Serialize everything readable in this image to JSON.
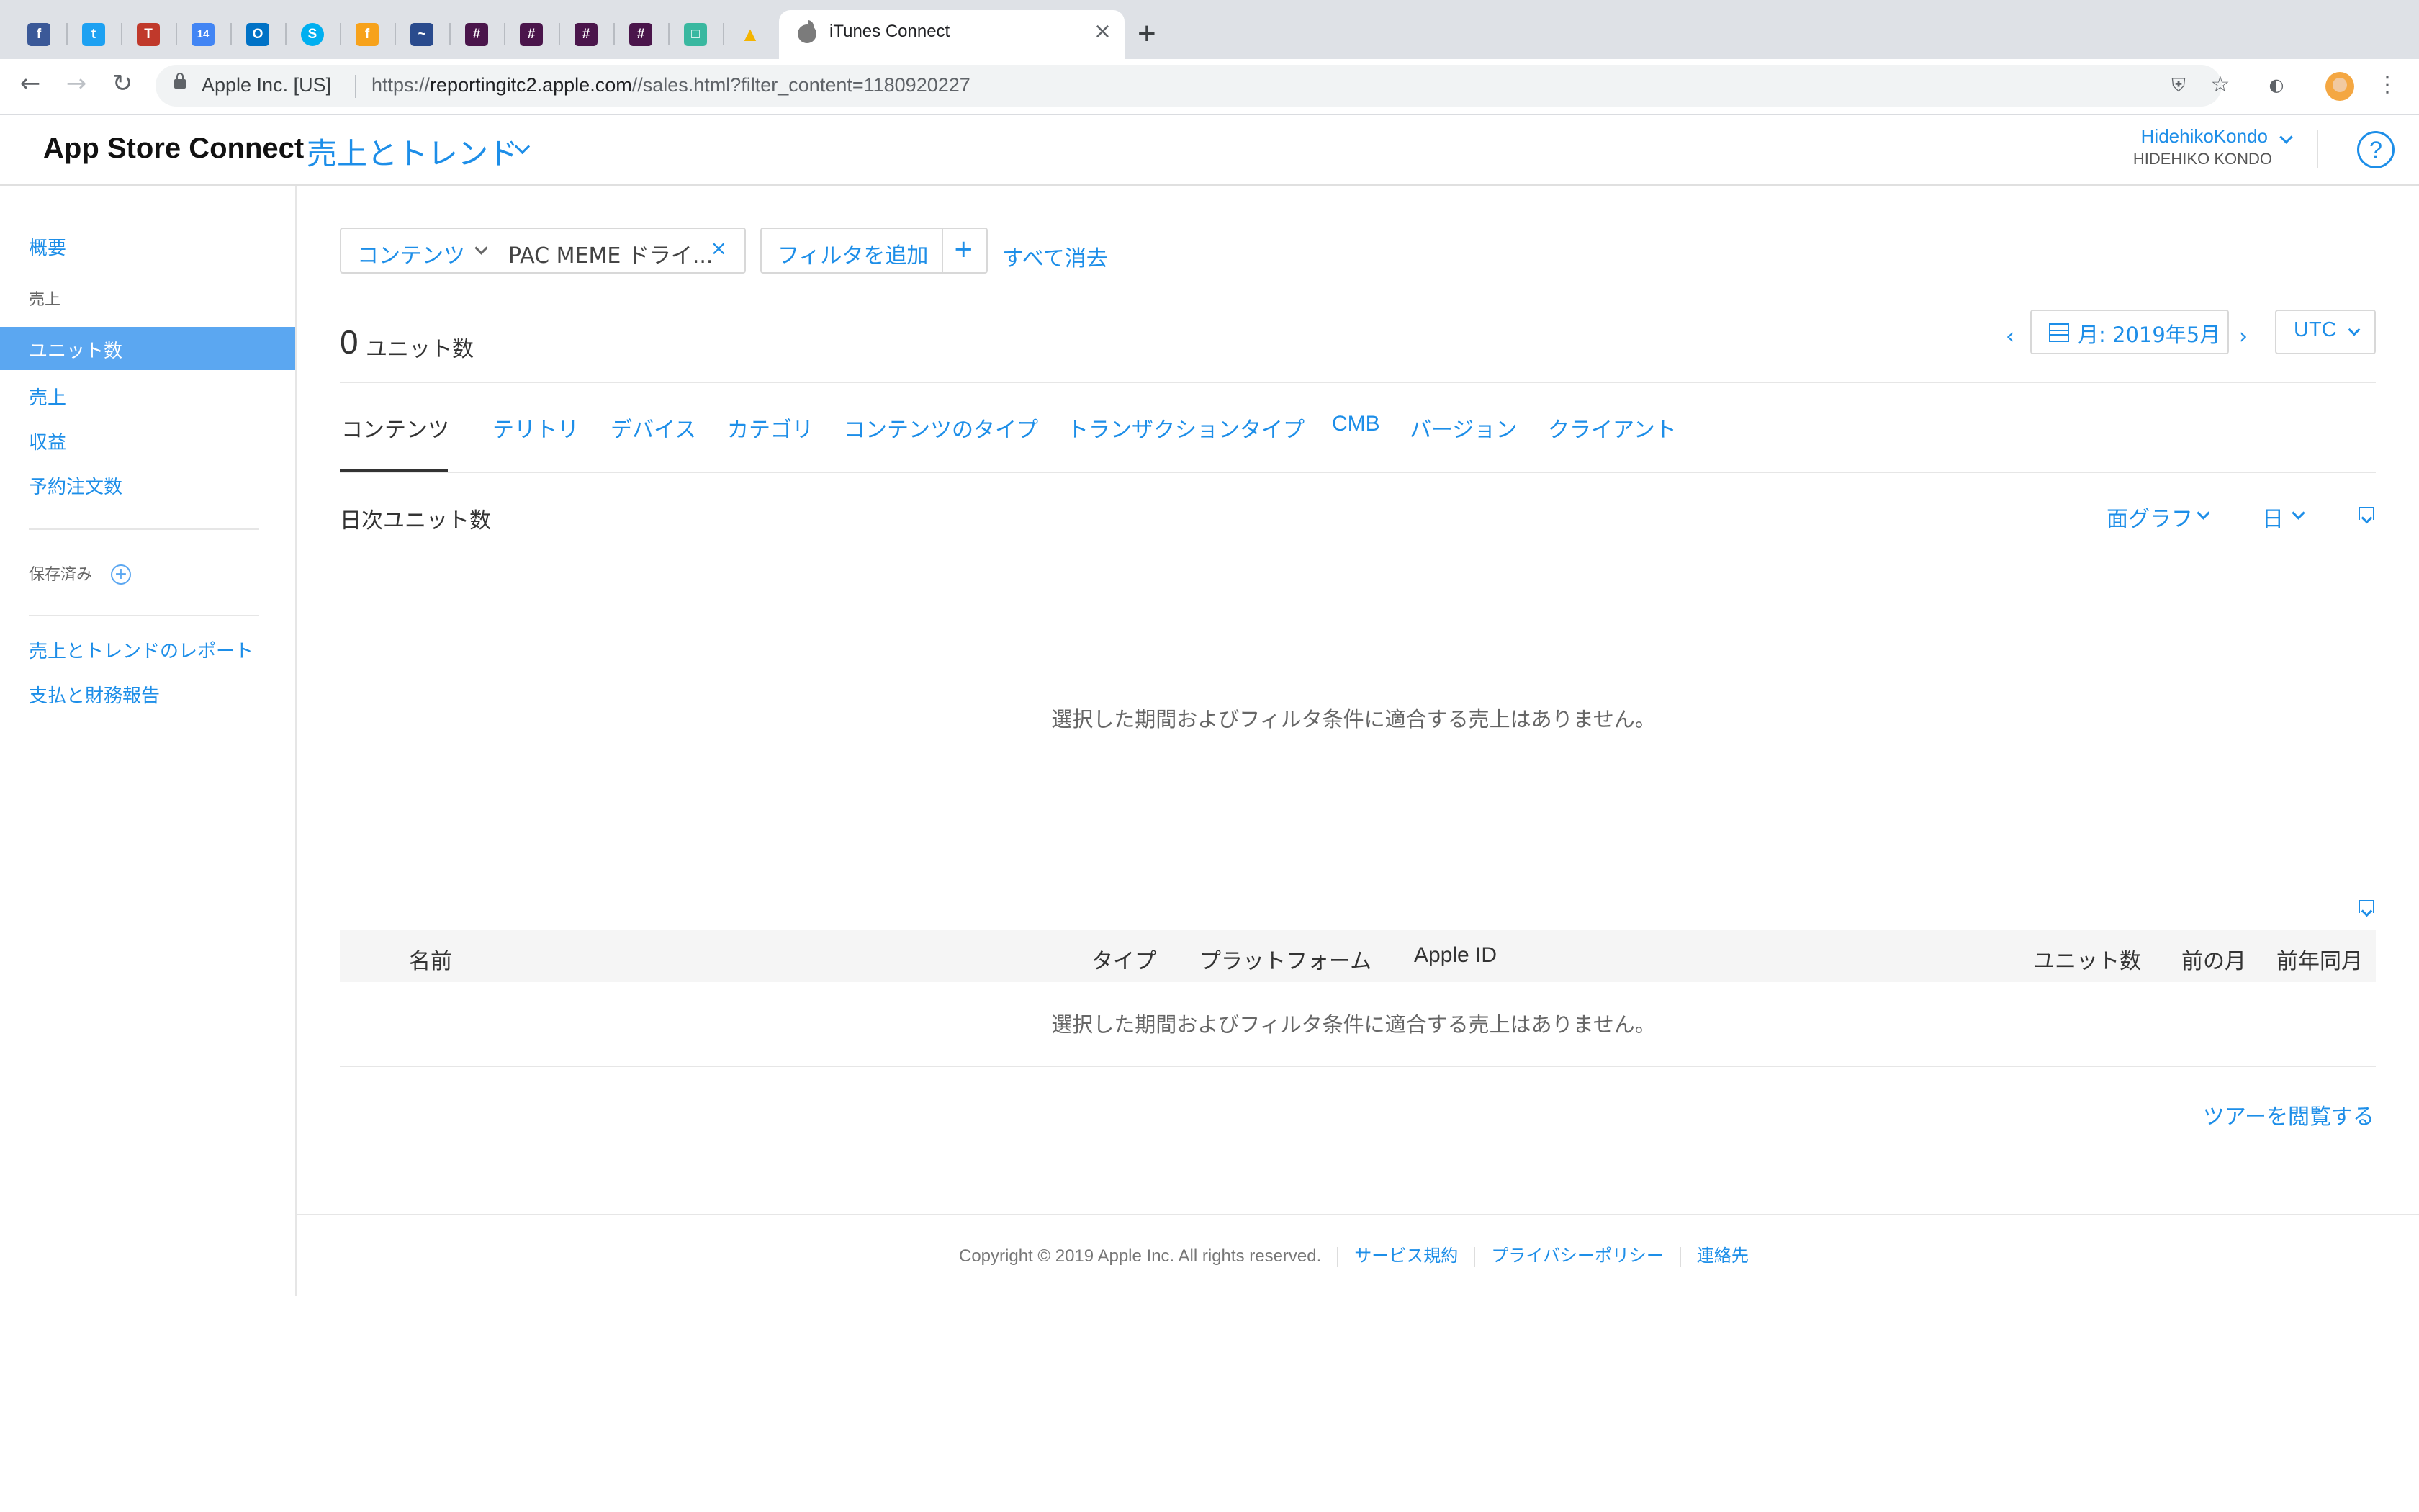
{
  "browser": {
    "pinned_tabs": [
      {
        "icon": "facebook-icon",
        "glyph": "f",
        "color": "#3b5998"
      },
      {
        "icon": "twitter-icon",
        "glyph": "t",
        "color": "#1da1f2"
      },
      {
        "icon": "trello-icon",
        "glyph": "T",
        "color": "#c0392b"
      },
      {
        "icon": "calendar-icon",
        "glyph": "14",
        "color": "#4285f4"
      },
      {
        "icon": "outlook-icon",
        "glyph": "O",
        "color": "#0072c6"
      },
      {
        "icon": "skype-icon",
        "glyph": "S",
        "color": "#00aff0"
      },
      {
        "icon": "feedly-icon",
        "glyph": "f",
        "color": "#f7a21b"
      },
      {
        "icon": "analytics-icon",
        "glyph": "~",
        "color": "#2a4b8d"
      },
      {
        "icon": "slack-icon",
        "glyph": "#",
        "color": "#4a154b"
      },
      {
        "icon": "slack-icon",
        "glyph": "#",
        "color": "#4a154b"
      },
      {
        "icon": "slack-icon",
        "glyph": "#",
        "color": "#4a154b"
      },
      {
        "icon": "slack-icon",
        "glyph": "#",
        "color": "#4a154b"
      },
      {
        "icon": "notes-icon",
        "glyph": "□",
        "color": "#39b8a0"
      },
      {
        "icon": "google-drive-icon",
        "glyph": "▲",
        "color": "#f4b400"
      }
    ],
    "active_tab_title": "iTunes Connect",
    "cert_label": "Apple Inc. [US]",
    "url_prefix": "https://",
    "url_host": "reportingitc2.apple.com",
    "url_path": "//sales.html?filter_content=1180920227"
  },
  "header": {
    "brand": "App Store Connect",
    "section": "売上とトレンド",
    "user_name": "HidehikoKondo",
    "user_sub": "HIDEHIKO KONDO",
    "help": "?"
  },
  "sidebar": {
    "overview": "概要",
    "sales_heading": "売上",
    "items": [
      "ユニット数",
      "売上",
      "収益",
      "予約注文数"
    ],
    "saved": "保存済み",
    "links": [
      "売上とトレンドのレポート",
      "支払と財務報告"
    ]
  },
  "filters": {
    "key": "コンテンツ",
    "value": "PAC MEME ドライ...",
    "remove": "×",
    "add_label": "フィルタを追加",
    "add_plus": "+",
    "clear_all": "すべて消去"
  },
  "summary": {
    "total": "0",
    "unit_label": "ユニット数",
    "date_label": "月: 2019年5月",
    "timezone": "UTC"
  },
  "tabs": [
    "コンテンツ",
    "テリトリ",
    "デバイス",
    "カテゴリ",
    "コンテンツのタイプ",
    "トランザクションタイプ",
    "CMB",
    "バージョン",
    "クライアント"
  ],
  "chart": {
    "title": "日次ユニット数",
    "type_control": "面グラフ",
    "interval_control": "日",
    "empty_message": "選択した期間およびフィルタ条件に適合する売上はありません。"
  },
  "table": {
    "columns": [
      "名前",
      "タイプ",
      "プラットフォーム",
      "Apple ID",
      "ユニット数",
      "前の月",
      "前年同月"
    ],
    "empty_message": "選択した期間およびフィルタ条件に適合する売上はありません。"
  },
  "tour_link": "ツアーを閲覧する",
  "footer": {
    "copyright": "Copyright © 2019 Apple Inc. All rights reserved.",
    "links": [
      "サービス規約",
      "プライバシーポリシー",
      "連絡先"
    ]
  },
  "colors": {
    "accent": "#1d8ee8",
    "sidebar_active": "#5ba7f1",
    "tab_strip": "#dee1e6"
  }
}
